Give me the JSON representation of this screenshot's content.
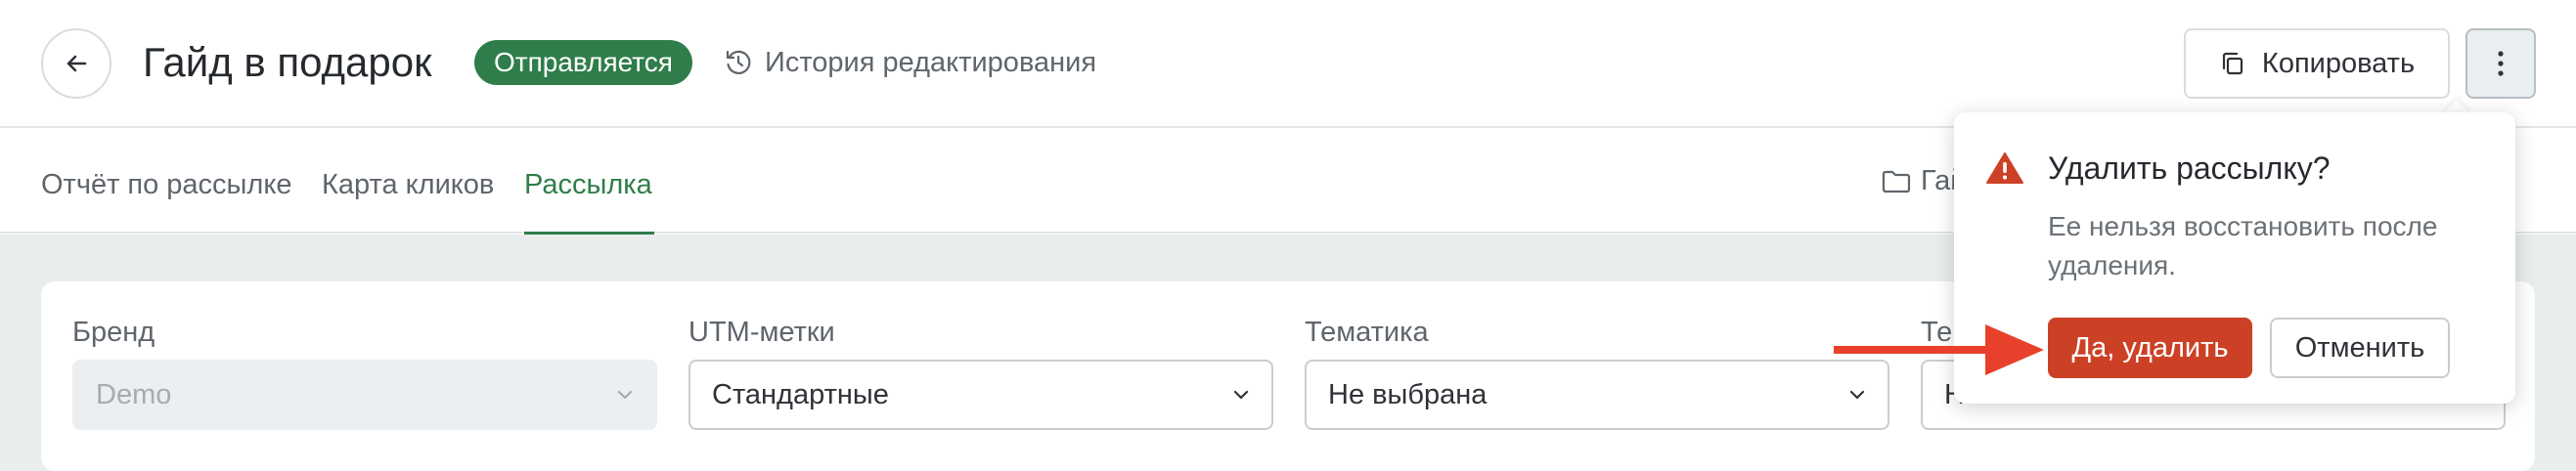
{
  "header": {
    "title": "Гайд в подарок",
    "status": "Отправляется",
    "history_label": "История редактирования",
    "copy_label": "Копировать",
    "status_color": "#2f7d4a"
  },
  "tabs": [
    {
      "label": "Отчёт по рассылке",
      "active": false
    },
    {
      "label": "Карта кликов",
      "active": false
    },
    {
      "label": "Рассылка",
      "active": true
    }
  ],
  "folder_label": "Гай",
  "form": {
    "fields": [
      {
        "label": "Бренд",
        "value": "Demo",
        "disabled": true
      },
      {
        "label": "UTM-метки",
        "value": "Стандартные",
        "disabled": false
      },
      {
        "label": "Тематика",
        "value": "Не выбрана",
        "disabled": false
      },
      {
        "label": "Те",
        "value": "Н",
        "disabled": false
      }
    ]
  },
  "popover": {
    "title": "Удалить рассылку?",
    "text": "Ее нельзя восстановить после удаления.",
    "confirm_label": "Да, удалить",
    "cancel_label": "Отменить",
    "danger_color": "#cc4126"
  },
  "icons": [
    "arrow-left-icon",
    "history-icon",
    "copy-icon",
    "more-vertical-icon",
    "folder-icon",
    "chevron-down-icon",
    "warning-icon",
    "annotation-arrow"
  ]
}
